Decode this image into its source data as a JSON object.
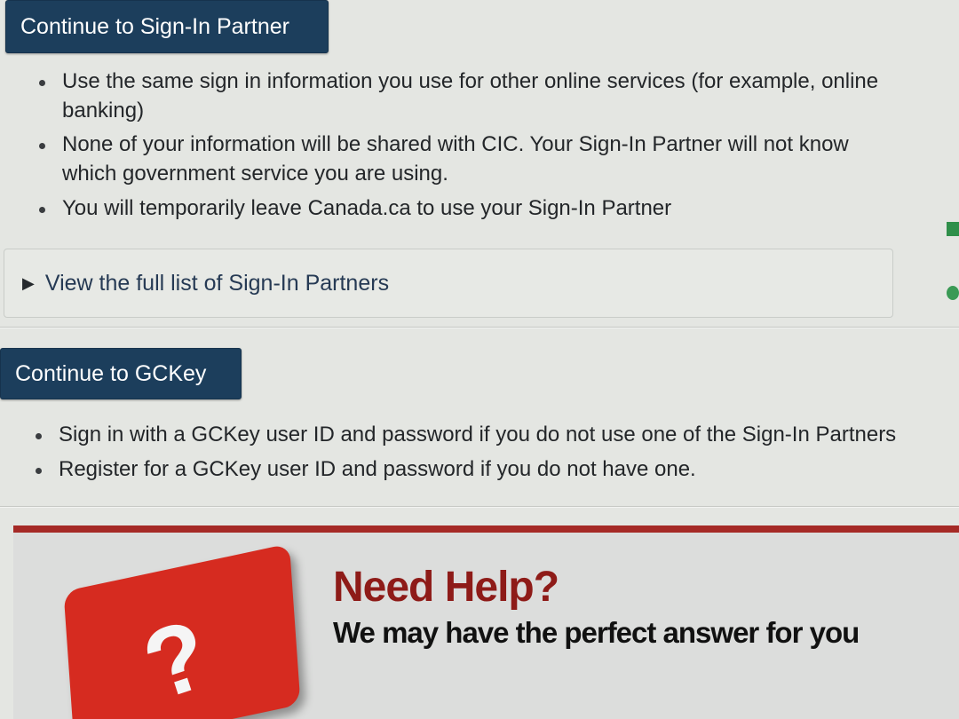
{
  "partner_section": {
    "button_label": "Continue to Sign-In Partner",
    "bullets": [
      "Use the same sign in information you use for other online services (for example, online banking)",
      "None of your information will be shared with CIC. Your Sign-In Partner will not know which government service you are using.",
      "You will temporarily leave Canada.ca to use your Sign-In Partner"
    ],
    "details_label": "View the full list of Sign-In Partners"
  },
  "gckey_section": {
    "button_label": "Continue to GCKey",
    "bullets": [
      "Sign in with a GCKey user ID and password if you do not use one of the Sign-In Partners",
      "Register for a GCKey user ID and password if you do not have one."
    ]
  },
  "help_banner": {
    "title": "Need Help?",
    "subtitle": "We may have the perfect answer for you",
    "key_glyph": "?"
  },
  "colors": {
    "button_bg": "#1c3e5c",
    "banner_rule": "#a52a26",
    "help_title": "#8e1b18"
  },
  "icons": {
    "details_toggle": "triangle-right-icon",
    "help_key": "question-key-icon"
  }
}
